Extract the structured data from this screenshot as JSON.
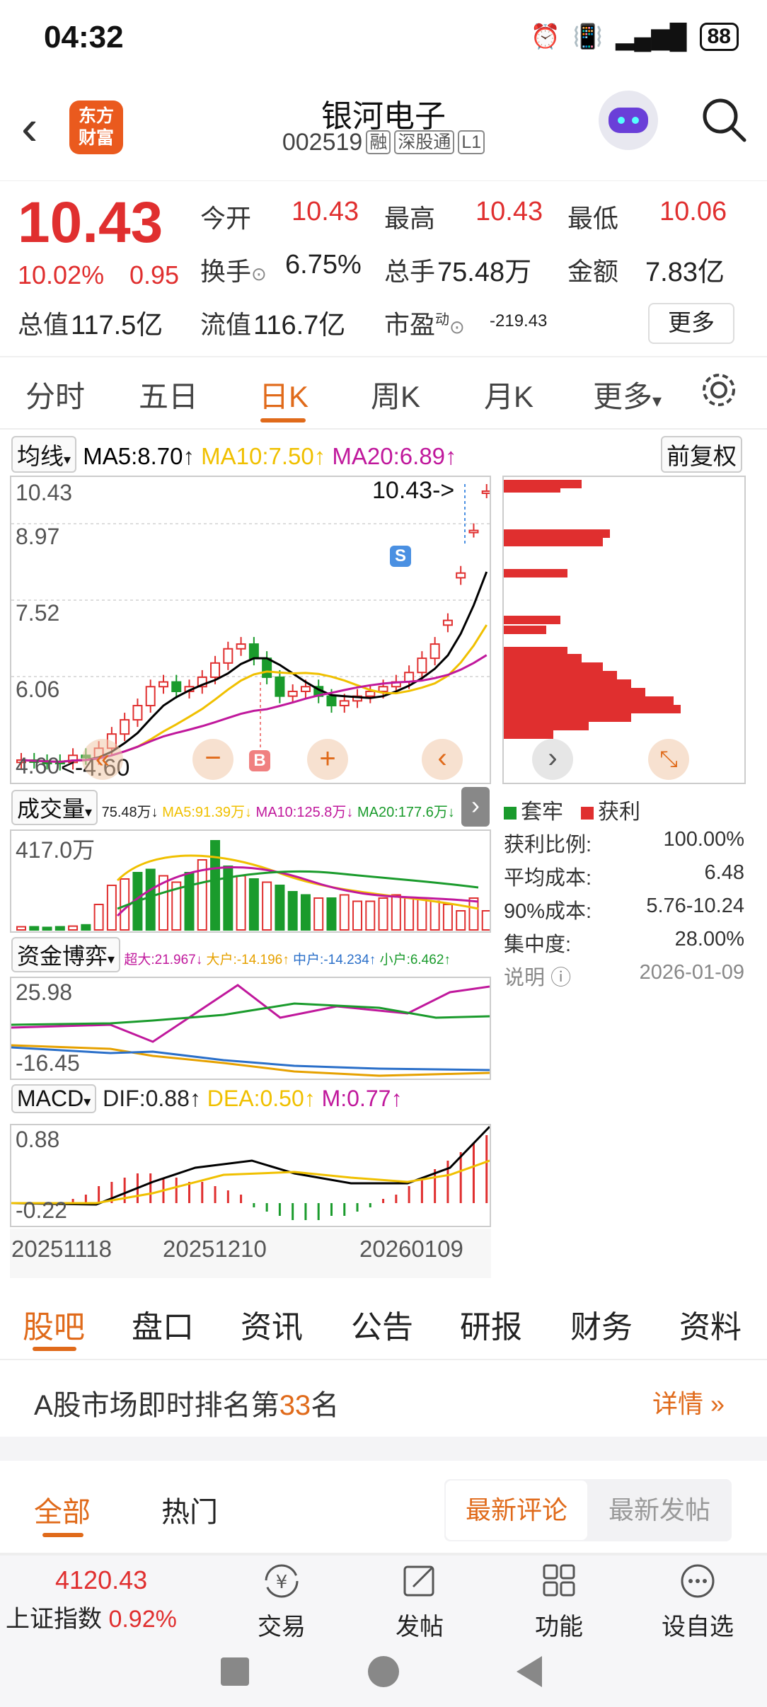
{
  "status_bar": {
    "time": "04:32",
    "battery": "88"
  },
  "header": {
    "logo_line1": "东方",
    "logo_line2": "财富",
    "stock_name": "银河电子",
    "stock_code": "002519",
    "tags": [
      "融",
      "深股通",
      "L1"
    ]
  },
  "quote": {
    "price": "10.43",
    "change_pct": "10.02%",
    "change": "0.95",
    "open_label": "今开",
    "open": "10.43",
    "high_label": "最高",
    "high": "10.43",
    "low_label": "最低",
    "low": "10.06",
    "turnover_label": "换手",
    "turnover": "6.75%",
    "volume_label": "总手",
    "volume": "75.48万",
    "amount_label": "金额",
    "amount": "7.83亿",
    "mktcap_label": "总值",
    "mktcap": "117.5亿",
    "float_label": "流值",
    "float_cap": "116.7亿",
    "pe_label": "市盈",
    "pe_sup": "动",
    "pe": "-219.43",
    "more": "更多"
  },
  "kline_tabs": [
    "分时",
    "五日",
    "日K",
    "周K",
    "月K",
    "更多"
  ],
  "ma_row": {
    "dropdown": "均线",
    "ma5": "MA5:8.70",
    "ma10": "MA10:7.50",
    "ma20": "MA20:6.89",
    "adjust": "前复权"
  },
  "colors": {
    "up": "#e02f2f",
    "down": "#1a9b2c",
    "ma5": "#000000",
    "ma10": "#f0c000",
    "ma20": "#c0189c",
    "accent": "#e06a1a"
  },
  "main_chart": {
    "y_labels": [
      "10.43",
      "8.97",
      "7.52",
      "6.06",
      "4.60"
    ],
    "last_label": "10.43->",
    "low_label": "<-4.60",
    "marker_b": "B",
    "marker_s": "S"
  },
  "volume": {
    "dropdown": "成交量",
    "vol": "75.48万↓",
    "ma5": "MA5:91.39万↓",
    "ma10": "MA10:125.8万↓",
    "ma20": "MA20:177.6万↓",
    "y_label": "417.0万"
  },
  "fund": {
    "dropdown": "资金博弈",
    "super": "超大:21.967↓",
    "large": "大户:-14.196↑",
    "mid": "中户:-14.234↑",
    "small": "小户:6.462↑",
    "y_top": "25.98",
    "y_bottom": "-16.45"
  },
  "macd": {
    "dropdown": "MACD",
    "dif": "DIF:0.88↑",
    "dea": "DEA:0.50↑",
    "m": "M:0.77↑",
    "y_top": "0.88",
    "y_bottom": "-0.22"
  },
  "dates": [
    "20251118",
    "20251210",
    "20260109"
  ],
  "cost": {
    "legend_trapped": "套牢",
    "legend_profit": "获利",
    "rows": [
      {
        "label": "获利比例:",
        "value": "100.00%"
      },
      {
        "label": "平均成本:",
        "value": "6.48"
      },
      {
        "label": "90%成本:",
        "value": "5.76-10.24"
      },
      {
        "label": "集中度:",
        "value": "28.00%"
      }
    ],
    "note_label": "说明",
    "note_date": "2026-01-09"
  },
  "section_tabs": [
    "股吧",
    "盘口",
    "资讯",
    "公告",
    "研报",
    "财务",
    "资料"
  ],
  "rank": {
    "prefix": "A股市场即时排名第",
    "num": "33",
    "suffix": "名",
    "detail": "详情"
  },
  "feed": {
    "tab_all": "全部",
    "tab_hot": "热门",
    "latest_comment": "最新评论",
    "latest_post": "最新发帖"
  },
  "bottom": {
    "index_value": "4120.43",
    "index_name": "上证指数",
    "index_pct": "0.92%",
    "trade": "交易",
    "post": "发帖",
    "function": "功能",
    "watch": "设自选"
  },
  "chart_data": {
    "type": "candlestick",
    "dates": [
      "20251118",
      "20251210",
      "20260109"
    ],
    "ylim": [
      4.6,
      10.43
    ],
    "series": [
      {
        "name": "MA5",
        "last": 8.7
      },
      {
        "name": "MA10",
        "last": 7.5
      },
      {
        "name": "MA20",
        "last": 6.89
      }
    ],
    "last_close": 10.43,
    "low": 4.6
  }
}
